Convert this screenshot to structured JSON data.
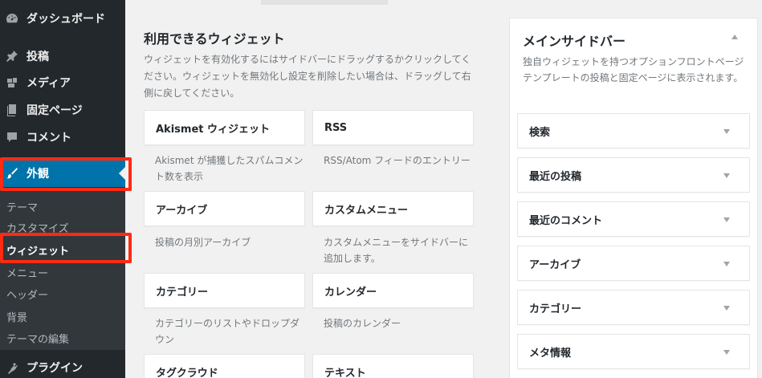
{
  "sidebar": {
    "menu": [
      {
        "label": "ダッシュボード",
        "icon": "dashboard-icon"
      },
      {
        "label": "投稿",
        "icon": "pin-icon"
      },
      {
        "label": "メディア",
        "icon": "media-icon"
      },
      {
        "label": "固定ページ",
        "icon": "page-icon"
      },
      {
        "label": "コメント",
        "icon": "comment-icon"
      },
      {
        "label": "外観",
        "icon": "brush-icon"
      },
      {
        "label": "プラグイン",
        "icon": "plugin-icon"
      }
    ],
    "submenu": [
      "テーマ",
      "カスタマイズ",
      "ウィジェット",
      "メニュー",
      "ヘッダー",
      "背景",
      "テーマの編集"
    ]
  },
  "available": {
    "title": "利用できるウィジェット",
    "description": "ウィジェットを有効化するにはサイドバーにドラッグするかクリックしてください。ウィジェットを無効化し設定を削除したい場合は、ドラッグして右側に戻してください。",
    "widgets": [
      {
        "name": "Akismet ウィジェット",
        "desc": "Akismet が捕獲したスパムコメント数を表示"
      },
      {
        "name": "RSS",
        "desc": "RSS/Atom フィードのエントリー"
      },
      {
        "name": "アーカイブ",
        "desc": "投稿の月別アーカイブ"
      },
      {
        "name": "カスタムメニュー",
        "desc": "カスタムメニューをサイドバーに追加します。"
      },
      {
        "name": "カテゴリー",
        "desc": "カテゴリーのリストやドロップダウン"
      },
      {
        "name": "カレンダー",
        "desc": "投稿のカレンダー"
      },
      {
        "name": "タグクラウド",
        "desc": ""
      },
      {
        "name": "テキスト",
        "desc": ""
      }
    ]
  },
  "main_sidebar": {
    "title": "メインサイドバー",
    "description": "独自ウィジェットを持つオプションフロントページテンプレートの投稿と固定ページに表示されます。",
    "widgets": [
      "検索",
      "最近の投稿",
      "最近のコメント",
      "アーカイブ",
      "カテゴリー",
      "メタ情報"
    ]
  },
  "colors": {
    "accent": "#0073aa",
    "highlight": "#ff2a12",
    "sidebar_bg": "#23282d"
  }
}
